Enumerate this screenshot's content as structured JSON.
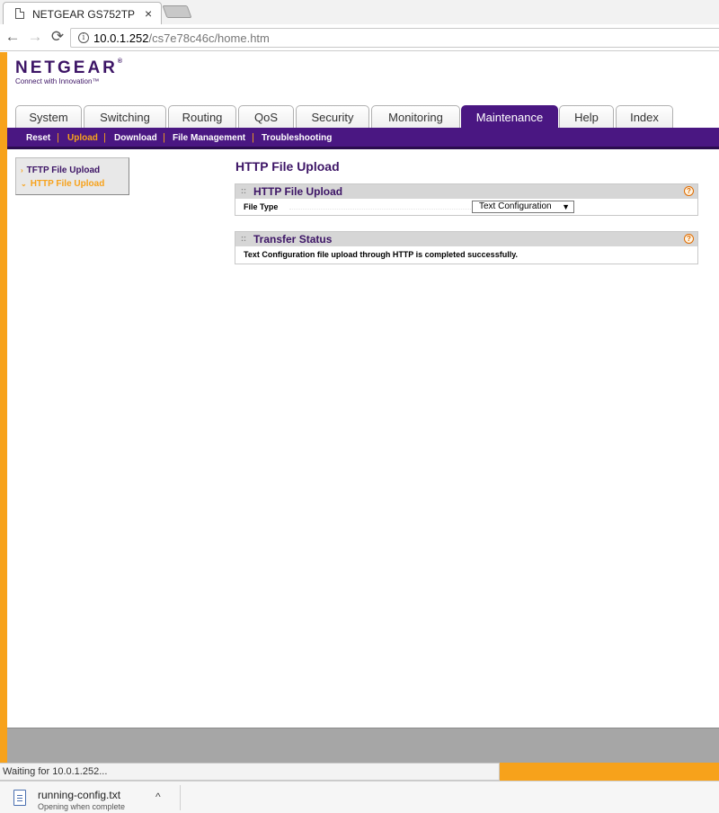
{
  "browser": {
    "tab_title": "NETGEAR GS752TP",
    "tab_close": "×",
    "url_host": "10.0.1.252",
    "url_path": "/cs7e78c46c/home.htm"
  },
  "brand": {
    "logo": "NETGEAR",
    "logo_mark": "®",
    "tagline": "Connect with Innovation™",
    "accent": "#f7a21b",
    "purple": "#4a1782"
  },
  "main_tabs": [
    "System",
    "Switching",
    "Routing",
    "QoS",
    "Security",
    "Monitoring",
    "Maintenance",
    "Help",
    "Index"
  ],
  "active_main_tab": "Maintenance",
  "sub_nav": [
    "Reset",
    "Upload",
    "Download",
    "File Management",
    "Troubleshooting"
  ],
  "active_sub_nav": "Upload",
  "side_menu": [
    {
      "label": "TFTP File Upload",
      "marker": "›"
    },
    {
      "label": "HTTP File Upload",
      "marker": "⌄"
    }
  ],
  "content": {
    "title": "HTTP File Upload",
    "upload_panel": {
      "title": "HTTP File Upload",
      "help": "?",
      "dots": "::",
      "field_label": "File Type",
      "field_value": "Text Configuration",
      "field_arrow": "▼"
    },
    "status_panel": {
      "title": "Transfer Status",
      "help": "?",
      "dots": "::",
      "message": "Text Configuration file upload through HTTP is completed successfully."
    }
  },
  "status_bar": "Waiting for 10.0.1.252...",
  "download": {
    "filename": "running-config.txt",
    "subtitle": "Opening when complete",
    "chevron": "^"
  }
}
